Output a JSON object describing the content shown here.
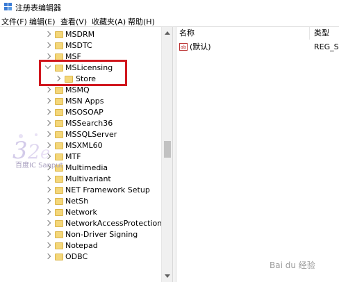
{
  "window": {
    "title": "注册表编辑器"
  },
  "menu": [
    "文件(F)",
    "编辑(E)",
    "查看(V)",
    "收藏夹(A)",
    "帮助(H)"
  ],
  "tree": {
    "items": [
      {
        "label": "MSDRM",
        "expanded": false
      },
      {
        "label": "MSDTC",
        "expanded": false
      },
      {
        "label": "MSF",
        "expanded": false
      },
      {
        "label": "MSLicensing",
        "expanded": true,
        "highlighted": true
      },
      {
        "label": "Store",
        "expanded": false,
        "child": true,
        "highlighted": true
      },
      {
        "label": "MSMQ",
        "expanded": false
      },
      {
        "label": "MSN Apps",
        "expanded": false
      },
      {
        "label": "MSOSOAP",
        "expanded": false
      },
      {
        "label": "MSSearch36",
        "expanded": false
      },
      {
        "label": "MSSQLServer",
        "expanded": false
      },
      {
        "label": "MSXML60",
        "expanded": false
      },
      {
        "label": "MTF",
        "expanded": false
      },
      {
        "label": "Multimedia",
        "expanded": false
      },
      {
        "label": "Multivariant",
        "expanded": false
      },
      {
        "label": "NET Framework Setup",
        "expanded": false
      },
      {
        "label": "NetSh",
        "expanded": false
      },
      {
        "label": "Network",
        "expanded": false
      },
      {
        "label": "NetworkAccessProtection",
        "expanded": false
      },
      {
        "label": "Non-Driver Signing",
        "expanded": false
      },
      {
        "label": "Notepad",
        "expanded": false
      },
      {
        "label": "ODBC",
        "expanded": false
      }
    ]
  },
  "values_pane": {
    "columns": {
      "name": "名称",
      "type": "类型"
    },
    "rows": [
      {
        "name": "(默认)",
        "type": "REG_SZ",
        "icon": "ab"
      }
    ]
  },
  "watermarks": {
    "left": "百度IC Sanput",
    "right": "Bai du 经验"
  },
  "colors": {
    "highlight_box": "#d0171e",
    "folder": "#f4d77a"
  }
}
